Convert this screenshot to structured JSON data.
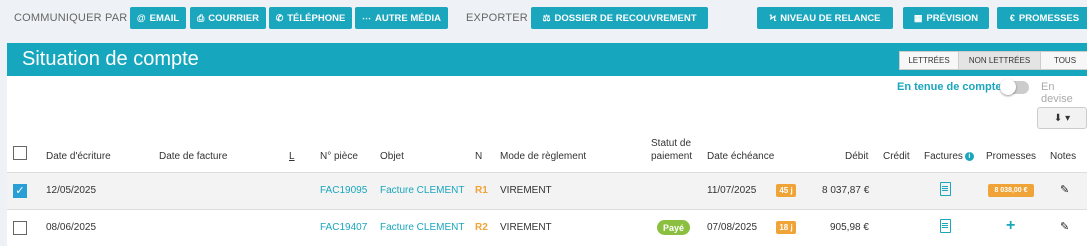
{
  "topbar": {
    "communiquer_label": "COMMUNIQUER PAR",
    "email": "EMAIL",
    "courrier": "COURRIER",
    "telephone": "TÉLÉPHONE",
    "autre_media": "AUTRE MÉDIA",
    "exporter_label": "EXPORTER",
    "dossier": "DOSSIER DE RECOUVREMENT",
    "niveau": "NIVEAU DE RELANCE",
    "prevision": "PRÉVISION",
    "promesses": "PROMESSES"
  },
  "panel": {
    "title": "Situation de compte",
    "filters": [
      "LETTRÉES",
      "NON LETTRÉES",
      "TOUS"
    ],
    "active_filter": "NON LETTRÉES",
    "tenue_label": "En tenue de compte",
    "devise_label": "En devise",
    "toggle_on": false
  },
  "columns": {
    "date_ecriture": "Date d'écriture",
    "date_facture": "Date de facture",
    "l": "L",
    "piece": "N° pièce",
    "objet": "Objet",
    "n": "N",
    "mode": "Mode de règlement",
    "statut_1": "Statut de",
    "statut_2": "paiement",
    "echeance": "Date échéance",
    "debit": "Débit",
    "credit": "Crédit",
    "factures": "Factures",
    "promesses": "Promesses",
    "notes": "Notes"
  },
  "rows": [
    {
      "checked": true,
      "date_ecriture": "12/05/2025",
      "date_facture": "",
      "piece": "FAC19095",
      "objet": "Facture CLEMENT",
      "n": "R1",
      "mode": "VIREMENT",
      "statut": "",
      "echeance": "11/07/2025",
      "days": "45 j",
      "debit": "8 037,87 €",
      "credit": "",
      "promesse": "8 038,00 €"
    },
    {
      "checked": false,
      "date_ecriture": "08/06/2025",
      "date_facture": "",
      "piece": "FAC19407",
      "objet": "Facture CLEMENT",
      "n": "R2",
      "mode": "VIREMENT",
      "statut": "Payé",
      "echeance": "07/08/2025",
      "days": "18 j",
      "debit": "905,98 €",
      "credit": "",
      "promesse": ""
    }
  ],
  "colors": {
    "accent": "#1aa6bd",
    "orange": "#f0a336",
    "green": "#8bbf3f"
  }
}
